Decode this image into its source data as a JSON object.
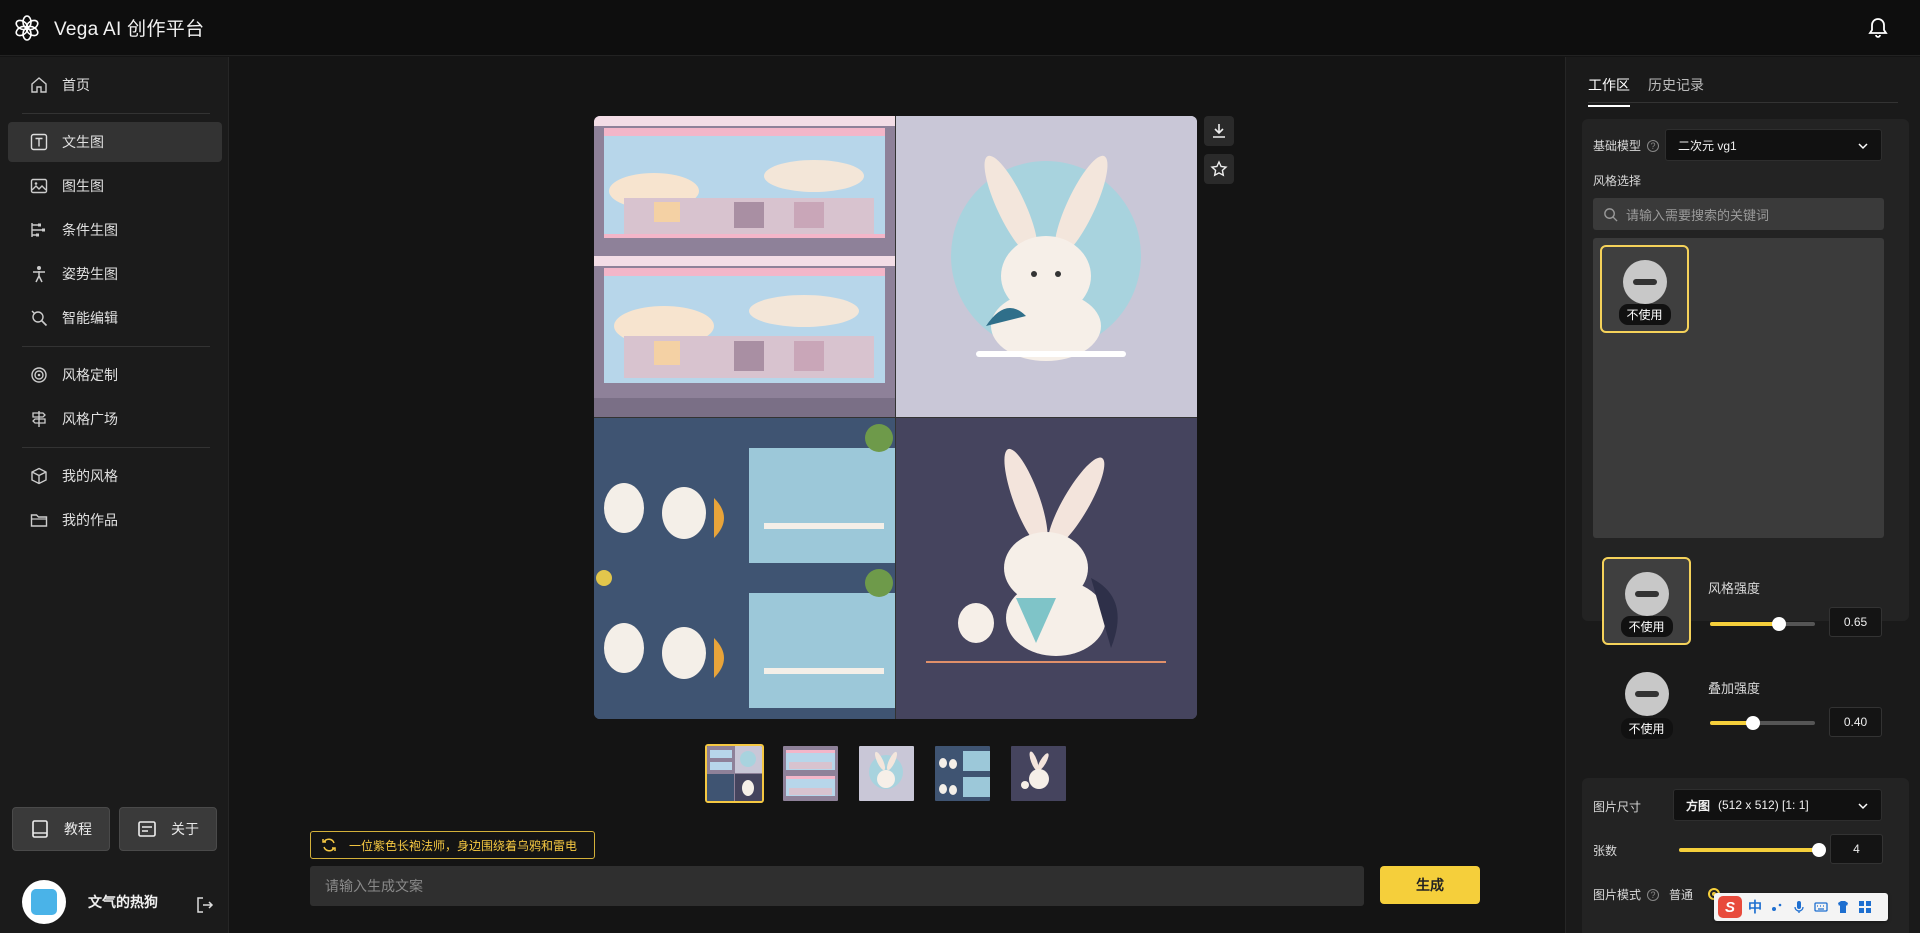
{
  "app": {
    "title": "Vega AI 创作平台"
  },
  "nav": {
    "items": [
      {
        "label": "首页",
        "icon": "home-icon"
      },
      {
        "label": "文生图",
        "icon": "text-icon",
        "active": true
      },
      {
        "label": "图生图",
        "icon": "image-icon"
      },
      {
        "label": "条件生图",
        "icon": "condition-icon"
      },
      {
        "label": "姿势生图",
        "icon": "pose-icon"
      },
      {
        "label": "智能编辑",
        "icon": "smart-edit-icon"
      },
      {
        "label": "风格定制",
        "icon": "target-icon"
      },
      {
        "label": "风格广场",
        "icon": "signpost-icon"
      },
      {
        "label": "我的风格",
        "icon": "cube-icon"
      },
      {
        "label": "我的作品",
        "icon": "folder-icon"
      }
    ],
    "tutorial_label": "教程",
    "about_label": "关于"
  },
  "user": {
    "name": "文气的热狗"
  },
  "main": {
    "suggestion": "一位紫色长袍法师，身边围绕着乌鸦和雷电",
    "prompt_placeholder": "请输入生成文案",
    "generate_label": "生成",
    "thumbnails": 5,
    "selected_thumbnail": 1
  },
  "right": {
    "tabs": [
      "工作区",
      "历史记录"
    ],
    "active_tab": 0,
    "base_model_label": "基础模型",
    "base_model_value": "二次元 vg1",
    "style_select_label": "风格选择",
    "style_search_placeholder": "请输入需要搜索的关键词",
    "no_use_label": "不使用",
    "style_strength_label": "风格强度",
    "style_strength_value": "0.65",
    "overlay_strength_label": "叠加强度",
    "overlay_strength_value": "0.40",
    "image_size_label": "图片尺寸",
    "image_size_name": "方图",
    "image_size_value": "(512 x 512) [1: 1]",
    "count_label": "张数",
    "count_value": "4",
    "count_fraction": 1.0,
    "image_mode_label": "图片模式",
    "image_mode_option": "普通",
    "accent_color": "#f5cf3b"
  },
  "ime": {
    "label": "中"
  }
}
